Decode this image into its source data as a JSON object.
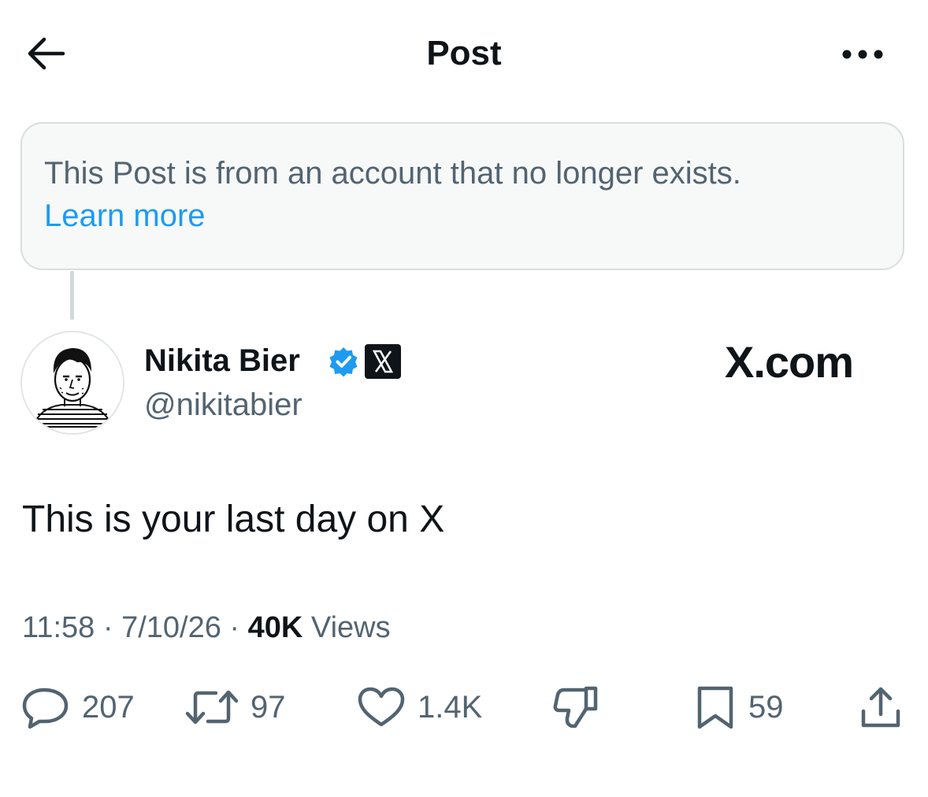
{
  "header": {
    "title": "Post"
  },
  "notice": {
    "message": "This Post is from an account that no longer exists.",
    "link": "Learn more"
  },
  "author": {
    "name": "Nikita Bier",
    "handle": "@nikitabier",
    "affiliation_text": "X.com"
  },
  "post": {
    "text": "This is your last day on X",
    "time": "11:58",
    "date": "7/10/26",
    "views_count": "40K",
    "views_label": "Views"
  },
  "actions": {
    "replies": "207",
    "reposts": "97",
    "likes": "1.4K",
    "bookmarks": "59"
  },
  "colors": {
    "accent": "#1d9bf0",
    "secondary_text": "#536471",
    "primary_text": "#0f1419"
  }
}
